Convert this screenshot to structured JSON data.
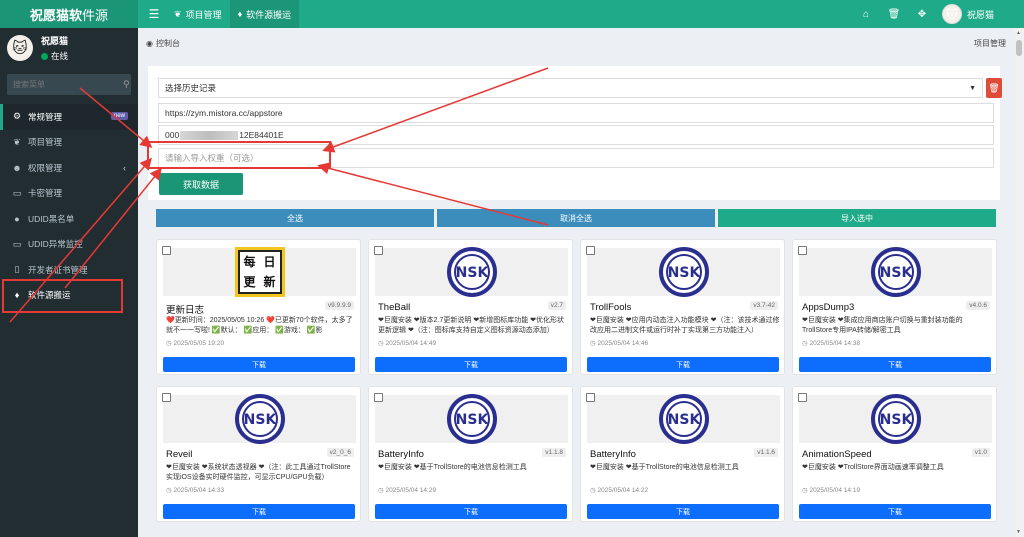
{
  "topbar": {
    "brand_main": "祝愿猫软",
    "brand_sub": "件源",
    "tabs": [
      {
        "label": "项目管理",
        "icon": "leaf-icon"
      },
      {
        "label": "软件源搬运",
        "icon": "diamond-icon"
      }
    ],
    "username": "祝愿猫"
  },
  "sidebar": {
    "username": "祝愿猫",
    "status": "在线",
    "search_placeholder": "搜索菜单",
    "items": [
      {
        "label": "常规管理",
        "badge": "new"
      },
      {
        "label": "项目管理"
      },
      {
        "label": "权限管理"
      },
      {
        "label": "卡密管理"
      },
      {
        "label": "UDID黑名单"
      },
      {
        "label": "UDID异常监控"
      },
      {
        "label": "开发者证书管理"
      },
      {
        "label": "软件源搬运"
      }
    ]
  },
  "header": {
    "breadcrumb": "控制台",
    "right": "项目管理"
  },
  "form": {
    "history_select": "选择历史记录",
    "url_value": "https://zym.mistora.cc/appstore",
    "udid_prefix": "000",
    "udid_suffix": "12E84401E",
    "weight_placeholder": "请输入导入权重（可选）",
    "fetch_button": "获取数据"
  },
  "actions": {
    "select_all": "全选",
    "deselect_all": "取消全选",
    "import_selected": "导入选中"
  },
  "apps": [
    {
      "name": "更新日志",
      "version": "v9.9.9.9",
      "date": "2025/05/05 19:20",
      "desc": "❤️更新时间：2025/05/05 10:26 ❤️已更新70个软件，太多了就不一一写啦! ✅默认： ✅应用： ✅游戏： ✅影",
      "logo": "daily",
      "download": "下载"
    },
    {
      "name": "TheBall",
      "version": "v2.7",
      "date": "2025/05/04 14:49",
      "desc": "❤巨魔安装 ❤版本2.7更新说明 ❤新增图标库功能 ❤优化形状更新逻辑 ❤（注：图标库支持自定义图标资源动态添加）",
      "logo": "nsk",
      "download": "下载"
    },
    {
      "name": "TrollFools",
      "version": "v3.7-42",
      "date": "2025/05/04 14:46",
      "desc": "❤巨魔安装 ❤应用内动态注入功能模块 ❤（注：该技术通过修改应用二进制文件或运行时补丁实现第三方功能注入）",
      "logo": "nsk",
      "download": "下载"
    },
    {
      "name": "AppsDump3",
      "version": "v4.0.6",
      "date": "2025/05/04 14:38",
      "desc": "❤巨魔安装 ❤集成应用商店账户切换与重封装功能的TrollStore专用IPA转储/解密工具",
      "logo": "nsk",
      "download": "下载"
    },
    {
      "name": "Reveil",
      "version": "v2_0_6",
      "date": "2025/05/04 14:33",
      "desc": "❤巨魔安装 ❤系统状态透视器 ❤（注：此工具通过TrollStore实现iOS设备实时硬件监控，可显示CPU/GPU负载）",
      "logo": "nsk",
      "download": "下载"
    },
    {
      "name": "BatteryInfo",
      "version": "v1.1.8",
      "date": "2025/05/04 14:29",
      "desc": "❤巨魔安装 ❤基于TrollStore的电池信息检测工具",
      "logo": "nsk",
      "download": "下载"
    },
    {
      "name": "BatteryInfo",
      "version": "v1.1.6",
      "date": "2025/05/04 14:22",
      "desc": "❤巨魔安装 ❤基于TrollStore的电池信息检测工具",
      "logo": "nsk",
      "download": "下载"
    },
    {
      "name": "AnimationSpeed",
      "version": "v1.0",
      "date": "2025/05/04 14:19",
      "desc": "❤巨魔安装 ❤TrollStore界面动画速率调整工具",
      "logo": "nsk",
      "download": "下载"
    }
  ],
  "colors": {
    "topbar": "#1fab89",
    "sidebar": "#222d32",
    "select_all": "#3c8dbc",
    "deselect_all": "#3c8dbc",
    "import": "#1fab89",
    "download": "#0d6efd",
    "annotation": "#e53935"
  }
}
